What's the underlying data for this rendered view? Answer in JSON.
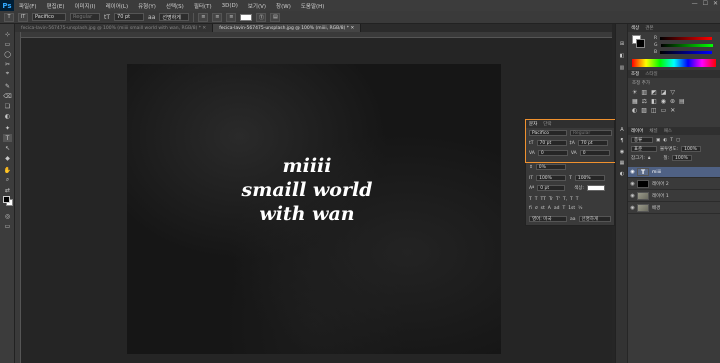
{
  "app": {
    "logo": "Ps"
  },
  "menu": [
    "파일(F)",
    "편집(E)",
    "이미지(I)",
    "레이어(L)",
    "유형(Y)",
    "선택(S)",
    "필터(T)",
    "3D(D)",
    "보기(V)",
    "창(W)",
    "도움말(H)"
  ],
  "window_controls": [
    "—",
    "☐",
    "✕"
  ],
  "options": {
    "tool_icon": "T",
    "orient_icon": "IT",
    "font_family": "Pacifico",
    "font_style": "Regular",
    "size_icon": "tT",
    "font_size": "70 pt",
    "aa_icon": "aa",
    "antialias": "선명하게",
    "text_color": "#ffffff"
  },
  "tabs": [
    {
      "label": "fecica-lavin-567475-unsplash.jpg @ 100% (miiii smaill world with wan, RGB/8) *  ✕",
      "active": false
    },
    {
      "label": "fecica-lavin-567475-unsplash.jpg @ 100% (miiii, RGB/8) *  ✕",
      "active": true
    }
  ],
  "canvas_text": [
    "miiii",
    "smaill world",
    "with wan"
  ],
  "char_panel": {
    "tabs": [
      "문자",
      "단락"
    ],
    "font_family": "Pacifico",
    "font_style": "Regular",
    "size_icon": "tT",
    "font_size": "70 pt",
    "leading_icon": "‡A",
    "leading": "70 pt",
    "kern_icon": "VA",
    "kerning": "0",
    "track_icon": "VA",
    "tracking": "0",
    "scale_icon": "⇕",
    "scale_pct": "0%",
    "v_scale_icon": "IT",
    "v_scale": "100%",
    "h_scale_icon": "T",
    "h_scale": "100%",
    "baseline_icon": "Aª",
    "baseline": "0 pt",
    "color_label": "색상:",
    "language": "영어: 미국",
    "aa_icon": "aa",
    "antialias": "선명하게",
    "glyph_buttons": [
      "T",
      "T",
      "TT",
      "Tr",
      "T'",
      "T,",
      "T",
      "T"
    ],
    "ligature_buttons": [
      "fi",
      "ơ",
      "st",
      "A",
      "ad",
      "T",
      "1st",
      "½"
    ]
  },
  "color_panel": {
    "tabs": [
      "색상",
      "견본"
    ],
    "channels": [
      {
        "label": "R",
        "color": "#d03030"
      },
      {
        "label": "G",
        "color": "#30b030"
      },
      {
        "label": "B",
        "color": "#3050d0"
      }
    ]
  },
  "adjust_panel": {
    "tabs": [
      "조정",
      "스타일"
    ],
    "add_label": "조정 추가"
  },
  "layers_panel": {
    "tabs": [
      "레이어",
      "채널",
      "패스"
    ],
    "kind_label": "종류",
    "blend_mode": "표준",
    "opacity_label": "불투명도:",
    "opacity": "100%",
    "lock_label": "잠그기:",
    "fill_label": "칠:",
    "fill": "100%",
    "eye_icon": "◉",
    "layers": [
      {
        "name": "miiii",
        "thumb": "text",
        "thumb_glyph": "T",
        "selected": true
      },
      {
        "name": "레이어 2",
        "thumb": "black",
        "thumb_glyph": "",
        "selected": false
      },
      {
        "name": "레이어 1",
        "thumb": "photo",
        "thumb_glyph": "",
        "selected": false
      },
      {
        "name": "배경",
        "thumb": "photo",
        "thumb_glyph": "",
        "selected": false
      }
    ]
  },
  "toolbox": [
    "⊹",
    "▭",
    "◯",
    "✂",
    "⌖",
    "✎",
    "⌫",
    "❏",
    "◐",
    "✦",
    "T",
    "↖",
    "◆",
    "✋",
    "⌕",
    "⇄"
  ],
  "right_icons": [
    "⊞",
    "◧",
    "▥",
    "A",
    "¶",
    "◉",
    "▦",
    "◐"
  ]
}
